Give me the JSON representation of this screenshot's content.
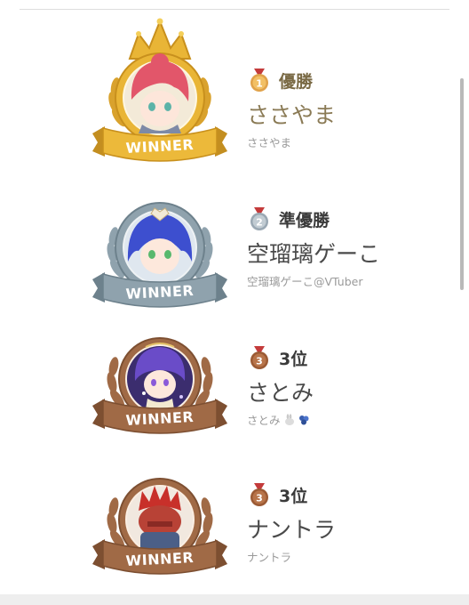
{
  "banner_text": "WINNER",
  "entries": [
    {
      "rank_number": "1",
      "rank_label": "優勝",
      "display_name": "ささやま",
      "handle": "ささやま",
      "frame": "gold-crown-frame",
      "medal_color": "#e0a24a"
    },
    {
      "rank_number": "2",
      "rank_label": "準優勝",
      "display_name": "空瑠璃ゲーこ",
      "handle": "空瑠璃ゲーこ@VTuber",
      "frame": "silver-frame",
      "medal_color": "#9aa8b3"
    },
    {
      "rank_number": "3",
      "rank_label": "3位",
      "display_name": "さとみ",
      "handle": "さとみ",
      "handle_emoji": [
        "rabbit-emoji",
        "blue-hydrangea-emoji"
      ],
      "frame": "bronze-frame",
      "medal_color": "#9b5a34"
    },
    {
      "rank_number": "3",
      "rank_label": "3位",
      "display_name": "ナントラ",
      "handle": "ナントラ",
      "frame": "bronze-frame",
      "medal_color": "#9b5a34"
    }
  ]
}
